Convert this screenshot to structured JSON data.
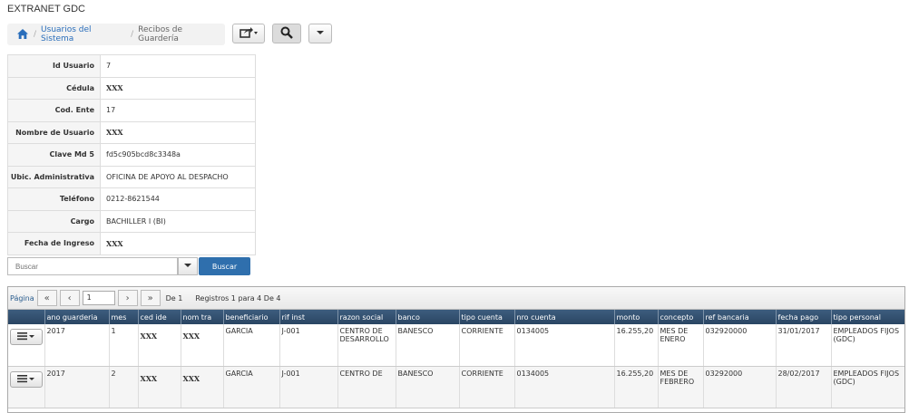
{
  "app_title": "EXTRANET GDC",
  "breadcrumb": {
    "item1": "Usuarios del Sistema",
    "item2": "Recibos de Guardería"
  },
  "toolbar": {
    "export_icon": "export-icon",
    "search_icon": "search-icon",
    "dropdown_icon": "chevron-down-icon"
  },
  "info": [
    {
      "label": "Id Usuario",
      "value": "7"
    },
    {
      "label": "Cédula",
      "value": "XXX"
    },
    {
      "label": "Cod. Ente",
      "value": "17"
    },
    {
      "label": "Nombre de Usuario",
      "value": "XXX"
    },
    {
      "label": "Clave Md 5",
      "value": "fd5c905bcd8c3348a"
    },
    {
      "label": "Ubic. Administrativa",
      "value": "OFICINA DE APOYO AL DESPACHO"
    },
    {
      "label": "Teléfono",
      "value": "0212-8621544"
    },
    {
      "label": "Cargo",
      "value": "BACHILLER I (BI)"
    },
    {
      "label": "Fecha de Ingreso",
      "value": "XXX"
    }
  ],
  "search": {
    "placeholder": "Buscar",
    "button": "Buscar"
  },
  "pager": {
    "label": "Página",
    "page": "1",
    "of": "De 1",
    "records": "Registros 1 para 4 De 4"
  },
  "columns": [
    "",
    "ano guarderia",
    "mes",
    "ced ide",
    "nom tra",
    "beneficiario",
    "rif inst",
    "razon social",
    "banco",
    "tipo cuenta",
    "nro cuenta",
    "monto",
    "concepto",
    "ref bancaria",
    "fecha pago",
    "tipo personal"
  ],
  "rows": [
    [
      "2017",
      "1",
      "XXX",
      "XXX",
      "GARCIA",
      "J-001",
      "CENTRO DE DESARROLLO",
      "BANESCO",
      "CORRIENTE",
      "0134005",
      "16.255,20",
      "MES DE ENERO",
      "032920000",
      "31/01/2017",
      "EMPLEADOS FIJOS (GDC)"
    ],
    [
      "2017",
      "2",
      "XXX",
      "XXX",
      "GARCIA",
      "J-001",
      "CENTRO DE",
      "BANESCO",
      "CORRIENTE",
      "0134005",
      "16.255,20",
      "MES DE FEBRERO",
      "03292000",
      "28/02/2017",
      "EMPLEADOS FIJOS (GDC)"
    ]
  ],
  "colors": {
    "accent": "#2f6fad",
    "header": "#2a4563",
    "link": "#2a6ebb"
  }
}
